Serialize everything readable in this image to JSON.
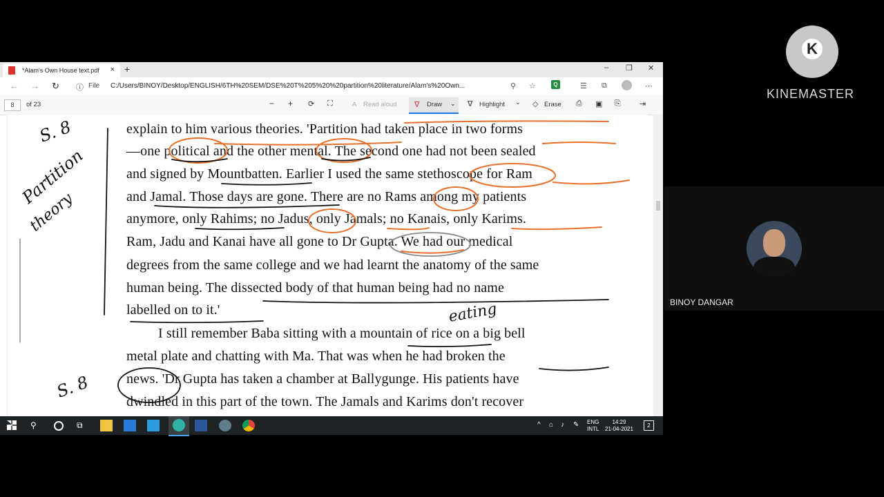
{
  "browser": {
    "tab_title": "*Alam's Own House text.pdf",
    "new_tab": "+",
    "close_tab": "×",
    "minimize": "–",
    "restore": "❐",
    "close": "✕",
    "address_label": "File",
    "url": "C:/Users/BINOY/Desktop/ENGLISH/6TH%20SEM/DSE%20T%205%20%20partition%20literature/Alam's%20Own...",
    "back": "←",
    "forward": "→",
    "refresh": "↻"
  },
  "pdf_toolbar": {
    "page_number": "8",
    "page_total": "of 23",
    "zoom_out": "−",
    "zoom_in": "+",
    "read_aloud": "Read aloud",
    "draw": "Draw",
    "highlight": "Highlight",
    "erase": "Erase"
  },
  "document": {
    "lines": [
      "explain to him various theories. 'Partition had taken place in two forms",
      "—one political and the other mental. The second one had not been sealed",
      "and signed by Mountbatten. Earlier I used the same stethoscope for Ram",
      "and Jamal. Those days are gone. There are no Rams among my patients",
      "anymore, only Rahims; no Jadus, only Jamals; no Kanais, only Karims.",
      "Ram, Jadu and Kanai have all gone to Dr Gupta. We had our medical",
      "degrees from the same college and we had learnt the anatomy of the same",
      "human being. The dissected body of that human being had no name",
      "labelled on to it.'",
      "I still remember Baba sitting with a mountain of rice on a big bell",
      "metal plate and chatting with Ma. That was when he had broken the",
      "news. 'Dr Gupta has taken a chamber at Ballygunge. His patients have",
      "dwindled in this part of the town. The Jamals and Karims don't recover"
    ],
    "annotation_eating": "eating",
    "margin_note_1": "S. 8",
    "margin_note_2": "Partition",
    "margin_note_3": "theory",
    "margin_note_4": "S. 8"
  },
  "taskbar": {
    "lang_top": "ENG",
    "lang_bottom": "INTL",
    "time": "14:29",
    "date": "21-04-2021",
    "notif_count": "2"
  },
  "watermark": {
    "brand": "KINEMASTER",
    "logo_letter": "K"
  },
  "participant": {
    "name": "BINOY DANGAR"
  },
  "colors": {
    "ink_orange": "#e8702a",
    "ink_black": "#111111",
    "taskbar": "#1e2326"
  }
}
